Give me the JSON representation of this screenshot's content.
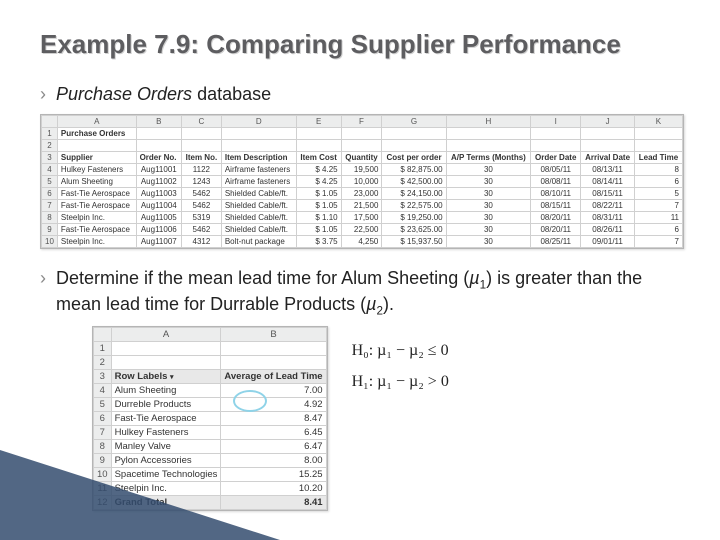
{
  "title": "Example 7.9: Comparing Supplier Performance",
  "bullet1_italic": "Purchase Orders",
  "bullet1_rest": " database",
  "po_table": {
    "cols": [
      "",
      "A",
      "B",
      "C",
      "D",
      "E",
      "F",
      "G",
      "H",
      "I",
      "J",
      "K"
    ],
    "header_label": "Purchase Orders",
    "field_row": [
      "Supplier",
      "Order No.",
      "Item No.",
      "Item Description",
      "Item Cost",
      "Quantity",
      "Cost per order",
      "A/P Terms (Months)",
      "Order Date",
      "Arrival Date",
      "Lead Time"
    ],
    "rows": [
      [
        "4",
        "Hulkey Fasteners",
        "Aug11001",
        "1122",
        "Airframe fasteners",
        "$   4.25",
        "19,500",
        "$   82,875.00",
        "30",
        "08/05/11",
        "08/13/11",
        "8"
      ],
      [
        "5",
        "Alum Sheeting",
        "Aug11002",
        "1243",
        "Airframe fasteners",
        "$   4.25",
        "10,000",
        "$   42,500.00",
        "30",
        "08/08/11",
        "08/14/11",
        "6"
      ],
      [
        "6",
        "Fast-Tie Aerospace",
        "Aug11003",
        "5462",
        "Shielded Cable/ft.",
        "$   1.05",
        "23,000",
        "$   24,150.00",
        "30",
        "08/10/11",
        "08/15/11",
        "5"
      ],
      [
        "7",
        "Fast-Tie Aerospace",
        "Aug11004",
        "5462",
        "Shielded Cable/ft.",
        "$   1.05",
        "21,500",
        "$   22,575.00",
        "30",
        "08/15/11",
        "08/22/11",
        "7"
      ],
      [
        "8",
        "Steelpin Inc.",
        "Aug11005",
        "5319",
        "Shielded Cable/ft.",
        "$   1.10",
        "17,500",
        "$   19,250.00",
        "30",
        "08/20/11",
        "08/31/11",
        "11"
      ],
      [
        "9",
        "Fast-Tie Aerospace",
        "Aug11006",
        "5462",
        "Shielded Cable/ft.",
        "$   1.05",
        "22,500",
        "$   23,625.00",
        "30",
        "08/20/11",
        "08/26/11",
        "6"
      ],
      [
        "10",
        "Steelpin Inc.",
        "Aug11007",
        "4312",
        "Bolt-nut package",
        "$   3.75",
        "4,250",
        "$   15,937.50",
        "30",
        "08/25/11",
        "09/01/11",
        "7"
      ]
    ]
  },
  "bullet2_parts": {
    "p1": "Determine if the mean lead time for Alum Sheeting (",
    "mu1": "µ",
    "s1": "1",
    "p2": ") is greater than the mean lead time for Durrable Products (",
    "mu2": "µ",
    "s2": "2",
    "p3": ")."
  },
  "lead_table": {
    "cols": [
      "",
      "A",
      "B"
    ],
    "header": [
      "Row Labels",
      "Average of Lead Time"
    ],
    "rows": [
      [
        "4",
        "Alum Sheeting",
        "7.00"
      ],
      [
        "5",
        "Durreble Products",
        "4.92"
      ],
      [
        "6",
        "Fast-Tie Aerospace",
        "8.47"
      ],
      [
        "7",
        "Hulkey Fasteners",
        "6.45"
      ],
      [
        "8",
        "Manley Valve",
        "6.47"
      ],
      [
        "9",
        "Pylon Accessories",
        "8.00"
      ],
      [
        "10",
        "Spacetime Technologies",
        "15.25"
      ],
      [
        "11",
        "Steelpin Inc.",
        "10.20"
      ],
      [
        "12",
        "Grand Total",
        "8.41"
      ]
    ]
  },
  "hypotheses": {
    "h0": "H₀:  µ₁  −  µ₂  ≤  0",
    "h1": "H₁:  µ₁  −  µ₂  >  0"
  }
}
